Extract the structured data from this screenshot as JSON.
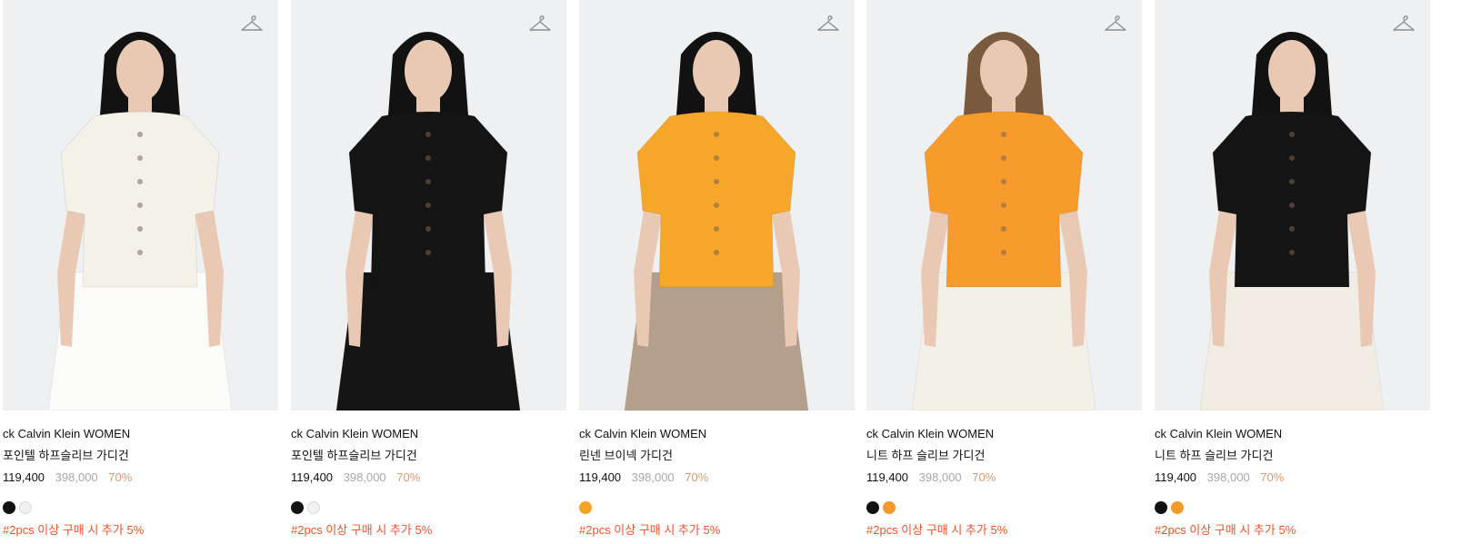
{
  "colors": {
    "photo_bg": "#eff0f2",
    "text": "#111111",
    "original_price": "#a8a8a8",
    "discount": "#d89a74",
    "promo": "#e8532c"
  },
  "products": [
    {
      "brand": "ck Calvin Klein WOMEN",
      "name": "포인텔 하프슬리브 가디건",
      "price": "119,400",
      "original_price": "398,000",
      "discount": "70%",
      "swatches": [
        "#111111",
        "#f1f1ef"
      ],
      "promo": "#2pcs 이상 구매 시 추가 5%",
      "top_color": "#f4f1e9",
      "bottom_color": "#fbfbf9",
      "icon": "hanger-icon"
    },
    {
      "brand": "ck Calvin Klein WOMEN",
      "name": "포인텔 하프슬리브 가디건",
      "price": "119,400",
      "original_price": "398,000",
      "discount": "70%",
      "swatches": [
        "#111111",
        "#f1f1ef"
      ],
      "promo": "#2pcs 이상 구매 시 추가 5%",
      "top_color": "#141414",
      "bottom_color": "#151515",
      "icon": "hanger-icon"
    },
    {
      "brand": "ck Calvin Klein WOMEN",
      "name": "린넨 브이넥 가디건",
      "price": "119,400",
      "original_price": "398,000",
      "discount": "70%",
      "swatches": [
        "#f4a425"
      ],
      "promo": "#2pcs 이상 구매 시 추가 5%",
      "top_color": "#f6a72a",
      "bottom_color": "#b49e8c",
      "icon": "hanger-icon"
    },
    {
      "brand": "ck Calvin Klein WOMEN",
      "name": "니트 하프 슬리브 가디건",
      "price": "119,400",
      "original_price": "398,000",
      "discount": "70%",
      "swatches": [
        "#111111",
        "#f39a2c"
      ],
      "promo": "#2pcs 이상 구매 시 추가 5%",
      "top_color": "#f89b2d",
      "bottom_color": "#f3f0e8",
      "icon": "hanger-icon"
    },
    {
      "brand": "ck Calvin Klein WOMEN",
      "name": "니트 하프 슬리브 가디건",
      "price": "119,400",
      "original_price": "398,000",
      "discount": "70%",
      "swatches": [
        "#111111",
        "#f39a2c"
      ],
      "promo": "#2pcs 이상 구매 시 추가 5%",
      "top_color": "#141414",
      "bottom_color": "#f1ede4",
      "icon": "hanger-icon"
    }
  ]
}
